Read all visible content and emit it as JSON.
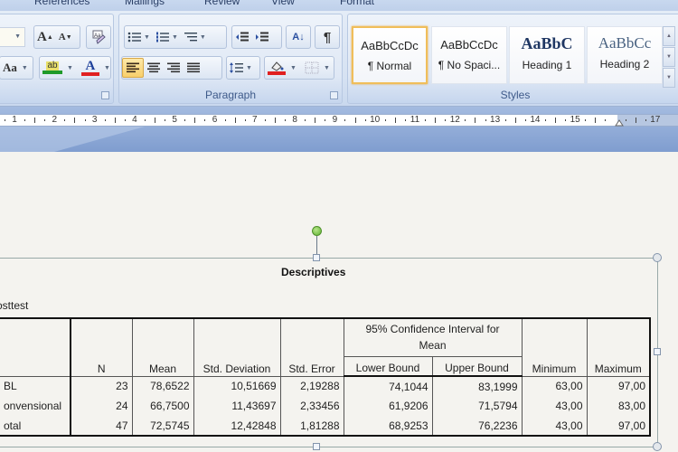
{
  "ribbon": {
    "tabs": [
      "References",
      "Mailings",
      "Review",
      "View",
      "Format"
    ],
    "groups": {
      "paragraph_label": "Paragraph",
      "styles_label": "Styles"
    },
    "font_buttons": {
      "grow_font": "A",
      "shrink_font": "A",
      "change_case": "Aa",
      "highlight": "ab",
      "font_color": "A"
    },
    "paragraph_buttons": {
      "sort": "A↓",
      "show_marks": "¶"
    },
    "styles": [
      {
        "sample": "AaBbCcDc",
        "name": "¶ Normal",
        "selected": true
      },
      {
        "sample": "AaBbCcDc",
        "name": "¶ No Spaci...",
        "selected": false
      },
      {
        "sample": "AaBbC",
        "name": "Heading 1",
        "selected": false
      },
      {
        "sample": "AaBbCc",
        "name": "Heading 2",
        "selected": false
      }
    ],
    "colors": {
      "highlight_bar": "#1f9a2a",
      "font_color_bar": "#e02020",
      "shading_bar": "#e02020",
      "active_button": "#f8cf6b"
    }
  },
  "ruler": {
    "labels": [
      "1",
      "2",
      "3",
      "4",
      "5",
      "6",
      "7",
      "8",
      "9",
      "10",
      "11",
      "12",
      "13",
      "14",
      "15",
      "17"
    ]
  },
  "document": {
    "table_title": "Descriptives",
    "variable_label": "osttest",
    "table": {
      "ci_header": "95% Confidence Interval for Mean",
      "columns": [
        "N",
        "Mean",
        "Std. Deviation",
        "Std. Error",
        "Lower Bound",
        "Upper Bound",
        "Minimum",
        "Maximum"
      ],
      "rows": [
        {
          "label": "BL",
          "values": [
            "23",
            "78,6522",
            "10,51669",
            "2,19288",
            "74,1044",
            "83,1999",
            "63,00",
            "97,00"
          ]
        },
        {
          "label": "onvensional",
          "values": [
            "24",
            "66,7500",
            "11,43697",
            "2,33456",
            "61,9206",
            "71,5794",
            "43,00",
            "83,00"
          ]
        },
        {
          "label": "otal",
          "values": [
            "47",
            "72,5745",
            "12,42848",
            "1,81288",
            "68,9253",
            "76,2236",
            "43,00",
            "97,00"
          ]
        }
      ]
    }
  }
}
